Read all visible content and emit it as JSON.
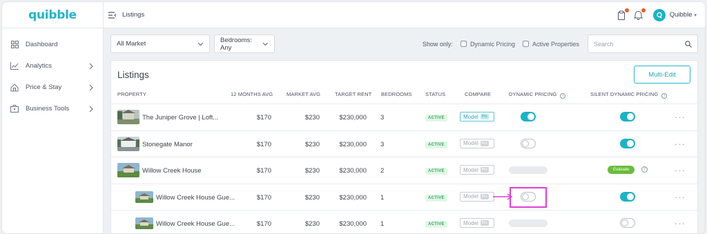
{
  "app": {
    "logo": "quibble"
  },
  "sidebar": {
    "items": [
      {
        "label": "Dashboard",
        "icon": "dashboard-icon",
        "has_chevron": false
      },
      {
        "label": "Analytics",
        "icon": "analytics-icon",
        "has_chevron": true
      },
      {
        "label": "Price & Stay",
        "icon": "price-stay-icon",
        "has_chevron": true
      },
      {
        "label": "Business Tools",
        "icon": "business-tools-icon",
        "has_chevron": true
      }
    ]
  },
  "topbar": {
    "title": "Listings",
    "user_name": "Quibble"
  },
  "filters": {
    "market": "All Market",
    "bedrooms": "Bedrooms: Any",
    "show_only": "Show only:",
    "dynamic_pricing": "Dynamic Pricing",
    "active_properties": "Active Properties",
    "search_placeholder": "Search"
  },
  "card": {
    "title": "Listings",
    "multi_edit": "Multi-Edit"
  },
  "table": {
    "headers": {
      "property": "PROPERTY",
      "avg12": "12 MONTHS AVG",
      "market_avg": "MARKET AVG",
      "target_rent": "TARGET RENT",
      "bedrooms": "BEDROOMS",
      "status": "STATUS",
      "compare": "COMPARE",
      "dynamic_pricing": "DYNAMIC PRICING",
      "silent_dynamic_pricing": "SILENT DYNAMIC PRICING"
    },
    "model_label": "Model",
    "pro_label": "Pro",
    "evaluate_label": "Evaluate",
    "rows": [
      {
        "name": "The Juniper Grove | Loft...",
        "avg12": "$170",
        "market_avg": "$230",
        "target_rent": "$230,000",
        "bedrooms": "3",
        "status": "ACTIVE"
      },
      {
        "name": "Stonegate Manor",
        "avg12": "$170",
        "market_avg": "$230",
        "target_rent": "$230,000",
        "bedrooms": "3",
        "status": "ACTIVE"
      },
      {
        "name": "Willow Creek House",
        "avg12": "$170",
        "market_avg": "$230",
        "target_rent": "$230,000",
        "bedrooms": "2",
        "status": "ACTIVE"
      },
      {
        "name": "Willow Creek House Gue...",
        "avg12": "$170",
        "market_avg": "$230",
        "target_rent": "$230,000",
        "bedrooms": "1",
        "status": "ACTIVE"
      },
      {
        "name": "Willow Creek House Gue...",
        "avg12": "$170",
        "market_avg": "$230",
        "target_rent": "$230,000",
        "bedrooms": "1",
        "status": "ACTIVE"
      }
    ]
  },
  "colors": {
    "accent": "#1ab3c6",
    "highlight": "#e23ad6",
    "active_green": "#2fae55",
    "evaluate_green": "#6abd3a"
  }
}
